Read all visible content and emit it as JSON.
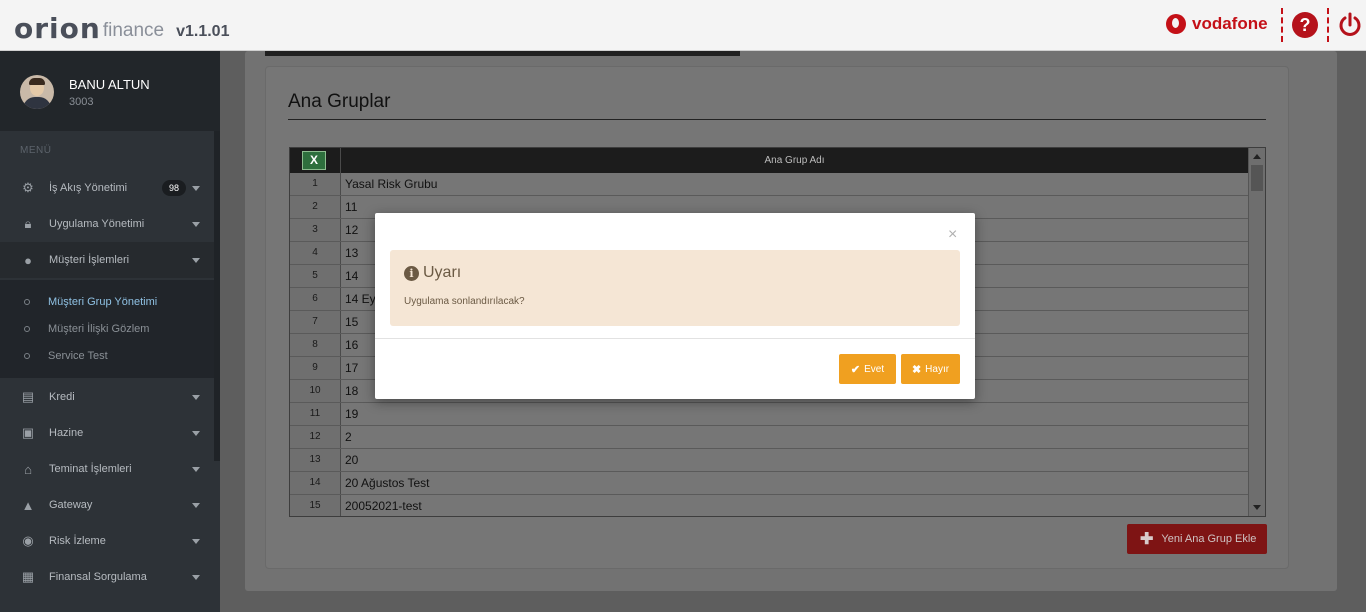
{
  "header": {
    "logo_orion": "orion",
    "logo_finance": "finance",
    "version": "v1.1.01",
    "operator": "vodafone",
    "help_icon": "question-circle-icon",
    "power_icon": "power-icon",
    "accent": "#c41017"
  },
  "user": {
    "name": "BANU ALTUN",
    "id": "3003"
  },
  "sidebar": {
    "menu_label": "MENÜ",
    "items": [
      {
        "label": "İş Akış Yönetimi",
        "icon": "cogs-icon",
        "badge": "98"
      },
      {
        "label": "Uygulama Yönetimi",
        "icon": "lock-icon"
      },
      {
        "label": "Müşteri İşlemleri",
        "icon": "user-circle-icon"
      },
      {
        "label": "Kredi",
        "icon": "id-card-icon"
      },
      {
        "label": "Hazine",
        "icon": "money-icon"
      },
      {
        "label": "Teminat İşlemleri",
        "icon": "home-icon"
      },
      {
        "label": "Gateway",
        "icon": "road-icon"
      },
      {
        "label": "Risk İzleme",
        "icon": "camera-icon"
      },
      {
        "label": "Finansal Sorgulama",
        "icon": "archive-icon"
      }
    ],
    "subitems": [
      {
        "label": "Müşteri Grup Yönetimi"
      },
      {
        "label": "Müşteri İlişki Gözlem"
      },
      {
        "label": "Service Test"
      }
    ]
  },
  "main": {
    "title": "Ana Gruplar",
    "excel_icon": "excel-icon",
    "column_header": "Ana Grup Adı",
    "rows": [
      {
        "n": "1",
        "name": "Yasal Risk Grubu"
      },
      {
        "n": "2",
        "name": "11"
      },
      {
        "n": "3",
        "name": "12"
      },
      {
        "n": "4",
        "name": "13"
      },
      {
        "n": "5",
        "name": "14"
      },
      {
        "n": "6",
        "name": "14 Ey"
      },
      {
        "n": "7",
        "name": "15"
      },
      {
        "n": "8",
        "name": "16"
      },
      {
        "n": "9",
        "name": "17"
      },
      {
        "n": "10",
        "name": "18"
      },
      {
        "n": "11",
        "name": "19"
      },
      {
        "n": "12",
        "name": "2"
      },
      {
        "n": "13",
        "name": "20"
      },
      {
        "n": "14",
        "name": "20 Ağustos Test"
      },
      {
        "n": "15",
        "name": "20052021-test"
      }
    ],
    "add_button": "Yeni Ana Grup Ekle"
  },
  "modal": {
    "close": "×",
    "title": "Uyarı",
    "message": "Uygulama sonlandırılacak?",
    "yes": "Evet",
    "no": "Hayır",
    "button_color": "#f0a020"
  }
}
